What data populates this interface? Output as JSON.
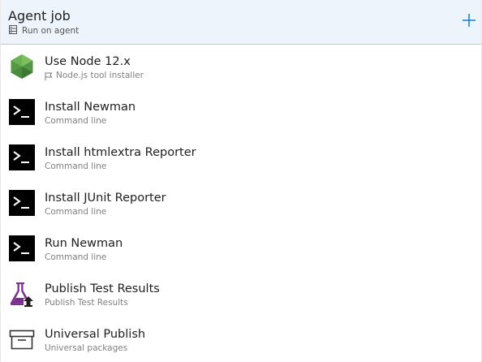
{
  "job": {
    "title": "Agent job",
    "subtitle": "Run on agent",
    "subtitle_icon": "server-icon",
    "add_icon": "plus-icon"
  },
  "tasks": [
    {
      "title": "Use Node 12.x",
      "subtitle": "Node.js tool installer",
      "icon": "nodejs-icon",
      "subtitle_icon": "flag-icon"
    },
    {
      "title": "Install Newman",
      "subtitle": "Command line",
      "icon": "command-line-icon"
    },
    {
      "title": "Install htmlextra Reporter",
      "subtitle": "Command line",
      "icon": "command-line-icon"
    },
    {
      "title": "Install JUnit Reporter",
      "subtitle": "Command line",
      "icon": "command-line-icon"
    },
    {
      "title": "Run Newman",
      "subtitle": "Command line",
      "icon": "command-line-icon"
    },
    {
      "title": "Publish Test Results",
      "subtitle": "Publish Test Results",
      "icon": "flask-upload-icon"
    },
    {
      "title": "Universal Publish",
      "subtitle": "Universal packages",
      "icon": "archive-box-icon"
    }
  ],
  "colors": {
    "header_bg": "#eef4fb",
    "node_green": "#5fa04e",
    "terminal_bg": "#000000",
    "flask_purple": "#7b2f8e",
    "accent": "#0078d4"
  }
}
